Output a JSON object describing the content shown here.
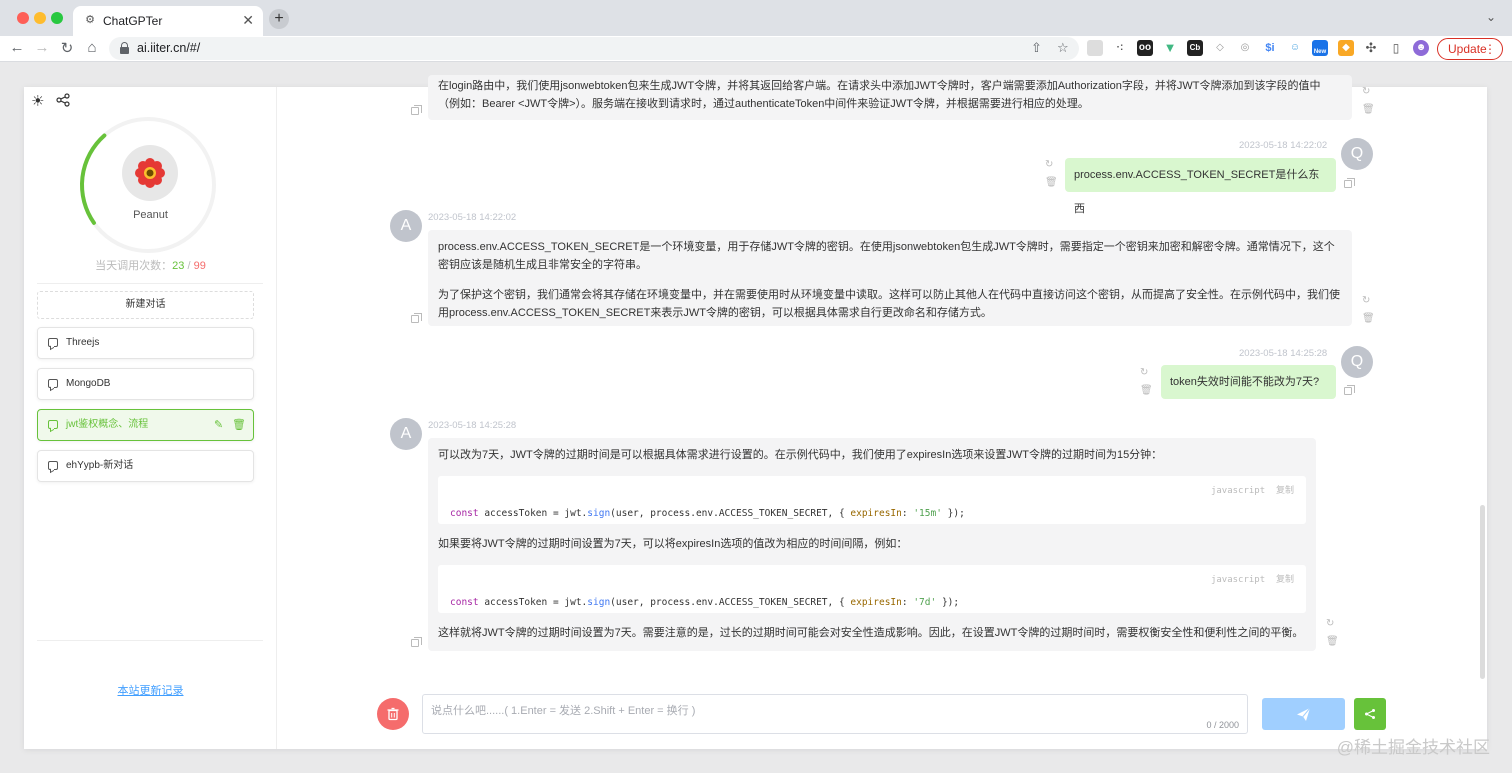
{
  "browser": {
    "tab_title": "ChatGPTer",
    "tab_close": "✕",
    "new_tab": "+",
    "url": "ai.iiter.cn/#/",
    "update_label": "Update",
    "update_dots": "⋮",
    "extension_new_badge": "New"
  },
  "sidebar": {
    "nickname": "Peanut",
    "usage_label": "当天调用次数：",
    "usage_used": "23",
    "usage_sep": " / ",
    "usage_limit": "99",
    "new_chat": "新建对话",
    "conversations": [
      {
        "label": "Threejs",
        "active": false
      },
      {
        "label": "MongoDB",
        "active": false
      },
      {
        "label": "jwt鉴权概念、流程",
        "active": true
      },
      {
        "label": "ehYypb-新对话",
        "active": false
      }
    ],
    "changelog": "本站更新记录"
  },
  "chat": {
    "messages": [
      {
        "role": "ai",
        "lines": [
          "在login路由中，我们使用jsonwebtoken包来生成JWT令牌，并将其返回给客户端。在请求头中添加JWT令牌时，客户端需要添加Authorization字段，并将JWT令牌添加到该字段的值中",
          "（例如：Bearer <JWT令牌>）。服务端在接收到请求时，通过authenticateToken中间件来验证JWT令牌，并根据需要进行相应的处理。"
        ]
      },
      {
        "role": "user",
        "avatar": "Q",
        "time": "2023-05-18 14:22:02",
        "text": "process.env.ACCESS_TOKEN_SECRET是什么东西"
      },
      {
        "role": "ai",
        "avatar": "A",
        "time": "2023-05-18 14:22:02",
        "lines": [
          "process.env.ACCESS_TOKEN_SECRET是一个环境变量，用于存储JWT令牌的密钥。在使用jsonwebtoken包生成JWT令牌时，需要指定一个密钥来加密和解密令牌。通常情况下，这个",
          "密钥应该是随机生成且非常安全的字符串。",
          "为了保护这个密钥，我们通常会将其存储在环境变量中，并在需要使用时从环境变量中读取。这样可以防止其他人在代码中直接访问这个密钥，从而提高了安全性。在示例代码中，我们使",
          "用process.env.ACCESS_TOKEN_SECRET来表示JWT令牌的密钥，可以根据具体需求自行更改命名和存储方式。"
        ]
      },
      {
        "role": "user",
        "avatar": "Q",
        "time": "2023-05-18 14:25:28",
        "text": "token失效时间能不能改为7天?"
      },
      {
        "role": "ai",
        "avatar": "A",
        "time": "2023-05-18 14:25:28",
        "p1": "可以改为7天，JWT令牌的过期时间是可以根据具体需求进行设置的。在示例代码中，我们使用了expiresIn选项来设置JWT令牌的过期时间为15分钟：",
        "code1": {
          "lang": "javascript",
          "copy": "复制",
          "kw": "const",
          "a": " accessToken = jwt.",
          "fn": "sign",
          "b": "(user, process.env.ACCESS_TOKEN_SECRET, { ",
          "prop": "expiresIn",
          "c": ": ",
          "str": "'15m'",
          "d": " });"
        },
        "p2": "如果要将JWT令牌的过期时间设置为7天，可以将expiresIn选项的值改为相应的时间间隔，例如：",
        "code2": {
          "lang": "javascript",
          "copy": "复制",
          "kw": "const",
          "a": " accessToken = jwt.",
          "fn": "sign",
          "b": "(user, process.env.ACCESS_TOKEN_SECRET, { ",
          "prop": "expiresIn",
          "c": ": ",
          "str": "'7d'",
          "d": " });"
        },
        "p3": "这样就将JWT令牌的过期时间设置为7天。需要注意的是，过长的过期时间可能会对安全性造成影响。因此，在设置JWT令牌的过期时间时，需要权衡安全性和便利性之间的平衡。"
      }
    ]
  },
  "input": {
    "placeholder": "说点什么吧......( 1.Enter = 发送   2.Shift + Enter = 换行 )",
    "counter": "0 / 2000"
  },
  "icons": {
    "refresh": "↻",
    "trash": "🗑",
    "share": "<"
  },
  "watermark": "@稀土掘金技术社区",
  "colors": {
    "accent": "#67c23a",
    "danger": "#f56c6c",
    "send": "#a0cfff",
    "user_bubble": "#d9f7cf",
    "ai_bubble": "#f4f4f5"
  }
}
